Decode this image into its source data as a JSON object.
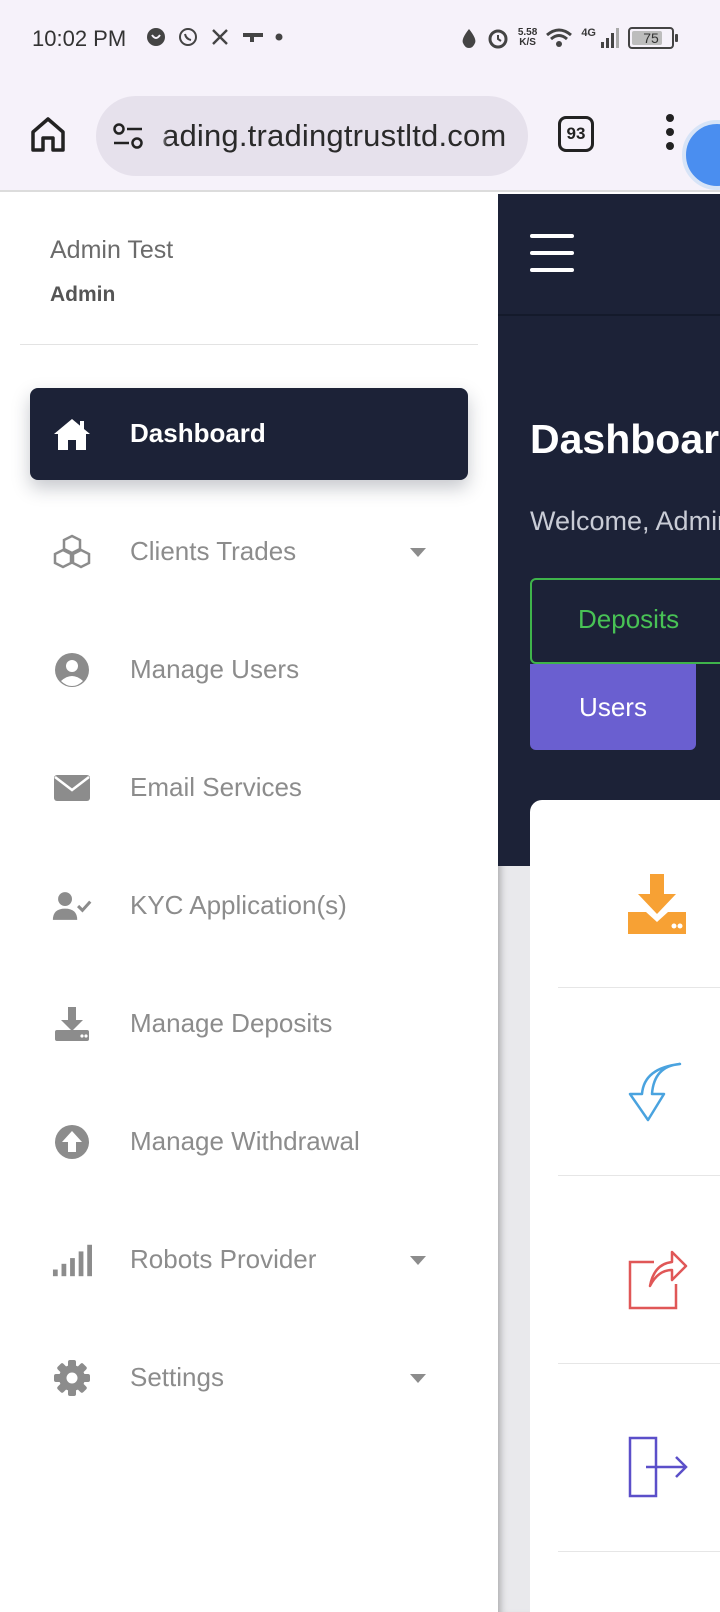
{
  "status_bar": {
    "time": "10:02 PM",
    "net_speed_value": "5.58",
    "net_speed_unit": "K/S",
    "network": "4G",
    "battery": "75"
  },
  "browser": {
    "url": "ading.tradingtrustltd.com",
    "tab_count": "93"
  },
  "sidebar": {
    "user_name": "Admin Test",
    "user_role": "Admin",
    "items": [
      {
        "label": "Dashboard",
        "icon": "home-icon",
        "active": true
      },
      {
        "label": "Clients Trades",
        "icon": "cubes-icon",
        "dropdown": true
      },
      {
        "label": "Manage Users",
        "icon": "user-circle-icon"
      },
      {
        "label": "Email Services",
        "icon": "envelope-icon"
      },
      {
        "label": "KYC Application(s)",
        "icon": "user-check-icon"
      },
      {
        "label": "Manage Deposits",
        "icon": "download-tray-icon"
      },
      {
        "label": "Manage Withdrawal",
        "icon": "upload-circle-icon"
      },
      {
        "label": "Robots Provider",
        "icon": "signal-bars-icon",
        "dropdown": true
      },
      {
        "label": "Settings",
        "icon": "gear-icon",
        "dropdown": true
      }
    ]
  },
  "main": {
    "title": "Dashboard",
    "welcome": "Welcome, Admin",
    "buttons": {
      "deposits": "Deposits",
      "users": "Users"
    },
    "card_icons": [
      "deposit-tray-icon",
      "curved-arrow-icon",
      "external-share-icon",
      "logout-icon"
    ]
  },
  "colors": {
    "sidebar_active_bg": "#1c2237",
    "main_dark_bg": "#1c2237",
    "deposits_green": "#48c255",
    "users_purple": "#6a5fd0",
    "icon_orange": "#f7a134",
    "icon_blue": "#4aa3df",
    "icon_red": "#e05757",
    "icon_indigo": "#5b4fc9"
  }
}
